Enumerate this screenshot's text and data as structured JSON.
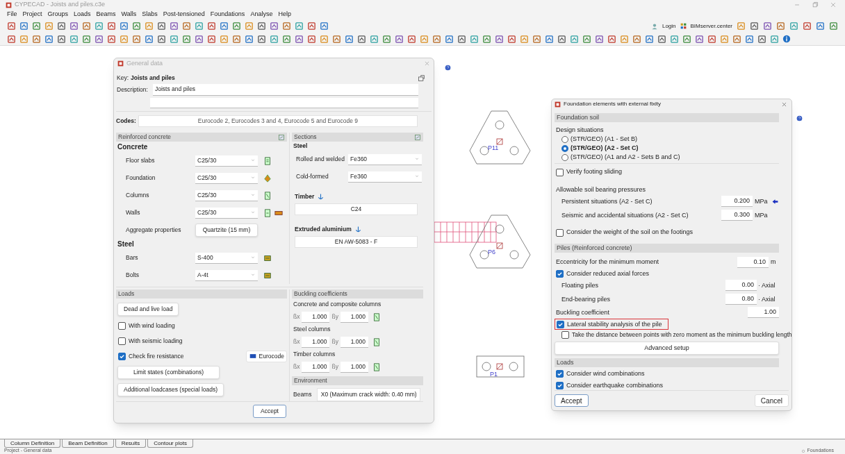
{
  "window": {
    "title": "CYPECAD - Joists and piles.c3e"
  },
  "menu": [
    "File",
    "Project",
    "Groups",
    "Loads",
    "Beams",
    "Walls",
    "Slabs",
    "Post-tensioned",
    "Foundations",
    "Analyse",
    "Help"
  ],
  "account": {
    "login": "Login",
    "server": "BIMserver.center"
  },
  "canvas": {
    "piles": [
      {
        "kind": "triangle",
        "label": "P11"
      },
      {
        "kind": "triangle",
        "label": "P6"
      },
      {
        "kind": "pair",
        "label": "P1"
      }
    ]
  },
  "general_data": {
    "title": "General data",
    "key_label": "Key:",
    "key": "Joists and piles",
    "description_label": "Description:",
    "description": "Joists and piles",
    "codes_label": "Codes:",
    "codes": "Eurocode 2, Eurocodes 3 and 4, Eurocode 5 and Eurocode 9",
    "concrete_panel": {
      "title": "Reinforced concrete",
      "concrete_heading": "Concrete",
      "concrete_rows": [
        {
          "label": "Floor slabs",
          "value": "C25/30"
        },
        {
          "label": "Foundation",
          "value": "C25/30"
        },
        {
          "label": "Columns",
          "value": "C25/30"
        },
        {
          "label": "Walls",
          "value": "C25/30"
        }
      ],
      "aggregate": {
        "label": "Aggregate properties",
        "value": "Quartzite (15 mm)"
      },
      "steel_heading": "Steel",
      "steel_rows": [
        {
          "label": "Bars",
          "value": "S-400"
        },
        {
          "label": "Bolts",
          "value": "A-4t"
        }
      ]
    },
    "sections_panel": {
      "title": "Sections",
      "steel_heading": "Steel",
      "steel_rows": [
        {
          "label": "Rolled and welded",
          "value": "Fe360"
        },
        {
          "label": "Cold-formed",
          "value": "Fe360"
        }
      ],
      "timber_label": "Timber",
      "timber": "C24",
      "aluminium_label": "Extruded aluminium",
      "aluminium": "EN AW-5083 - F"
    },
    "loads": {
      "title": "Loads",
      "dead_live": "Dead and live load",
      "checks": [
        {
          "label": "With wind loading",
          "checked": false
        },
        {
          "label": "With seismic loading",
          "checked": false
        },
        {
          "label": "Check fire resistance",
          "checked": true
        }
      ],
      "eurocode": "Eurocode",
      "limit_states": "Limit states (combinations)",
      "additional": "Additional loadcases (special loads)"
    },
    "buckling": {
      "title": "Buckling coefficients",
      "groups": [
        {
          "title": "Concrete and composite columns",
          "bx_label": "ßx",
          "bx": "1.000",
          "by_label": "ßy",
          "by": "1.000"
        },
        {
          "title": "Steel columns",
          "bx_label": "ßx",
          "bx": "1.000",
          "by_label": "ßy",
          "by": "1.000"
        },
        {
          "title": "Timber columns",
          "bx_label": "ßx",
          "bx": "1.000",
          "by_label": "ßy",
          "by": "1.000"
        }
      ]
    },
    "environment": {
      "title": "Environment",
      "label": "Beams",
      "value": "X0 (Maximum crack width: 0.40 mm)"
    },
    "accept": "Accept"
  },
  "foundation_dialog": {
    "title": "Foundation elements with external fixity",
    "soil_title": "Foundation soil",
    "design_label": "Design situations",
    "situations": [
      {
        "label": "(STR/GEO) (A1 - Set B)",
        "selected": false
      },
      {
        "label": "(STR/GEO) (A2 - Set C)",
        "selected": true
      },
      {
        "label": "(STR/GEO) (A1 and A2 - Sets B and C)",
        "selected": false
      }
    ],
    "sliding": {
      "label": "Verify footing sliding",
      "checked": false
    },
    "pressures_label": "Allowable soil bearing pressures",
    "pressures": [
      {
        "label": "Persistent situations (A2 - Set C)",
        "value": "0.200",
        "unit": "MPa"
      },
      {
        "label": "Seismic and accidental situations (A2 - Set C)",
        "value": "0.300",
        "unit": "MPa"
      }
    ],
    "soil_weight": {
      "label": "Consider the weight of the soil on the footings",
      "checked": false
    },
    "piles_title": "Piles (Reinforced concrete)",
    "eccentricity": {
      "label": "Eccentricity for the minimum moment",
      "value": "0.10",
      "unit": "m"
    },
    "reduced": {
      "label": "Consider reduced axial forces",
      "checked": true
    },
    "pile_rows": [
      {
        "label": "Floating piles",
        "value": "0.00",
        "unit": "· Axial"
      },
      {
        "label": "End-bearing piles",
        "value": "0.80",
        "unit": "· Axial"
      }
    ],
    "buckling": {
      "label": "Buckling coefficient",
      "value": "1.00"
    },
    "lateral": {
      "label": "Lateral stability analysis of the pile",
      "checked": true,
      "highlighted": true
    },
    "distance": {
      "label": "Take the distance between points with zero moment as the minimum buckling length",
      "checked": false
    },
    "advanced": "Advanced setup",
    "loads_title": "Loads",
    "load_checks": [
      {
        "label": "Consider wind combinations",
        "checked": true
      },
      {
        "label": "Consider earthquake combinations",
        "checked": true
      }
    ],
    "accept": "Accept",
    "cancel": "Cancel"
  },
  "tabs": [
    "Column Definition",
    "Beam Definition",
    "Results",
    "Contour plots"
  ],
  "status_bar": {
    "left": "Project - General data",
    "right": "Foundations"
  }
}
